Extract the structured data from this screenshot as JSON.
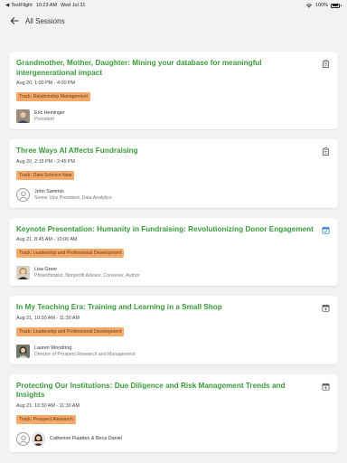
{
  "status": {
    "back_app": "TestFlight",
    "time": "10:23 AM",
    "date": "Wed Jul 31",
    "battery": "100%"
  },
  "nav": {
    "title": "All Sessions"
  },
  "sessions": [
    {
      "title": "Grandmother, Mother, Daughter: Mining your database for meaningful intergenerational impact",
      "time": "Aug 20, 1:00 PM - 4:00 PM",
      "track": "Track: Relationship Management",
      "speaker_name": "Eric Heininger",
      "speaker_role": "President",
      "icon": "clipboard-icon",
      "icon_color": "#555555"
    },
    {
      "title": "Three Ways AI Affects Fundraising",
      "time": "Aug 20, 2:15 PM - 2:45 PM",
      "track": "Track: Data Science Now",
      "speaker_name": "John Sammis",
      "speaker_role": "Senior Vice President, Data Analytics",
      "icon": "clipboard-icon",
      "icon_color": "#555555"
    },
    {
      "title": "Keynote Presentation: Humanity in Fundraising: Revolutionizing Donor Engagement",
      "time": "Aug 21, 8:45 AM - 10:00 AM",
      "track": "Track: Leadership and Professional Development",
      "speaker_name": "Lisa Greer",
      "speaker_role": "Philanthropist, Nonprofit Advisor, Convener, Author",
      "icon": "calendar-check-icon",
      "icon_color": "#2a7fd4"
    },
    {
      "title": "In My Teaching Era: Training and Learning in a Small Shop",
      "time": "Aug 21, 10:30 AM - 11:30 AM",
      "track": "Track: Leadership and Professional Development",
      "speaker_name": "Lauren Woodring",
      "speaker_role": "Director of Prospect Research and Management",
      "icon": "calendar-add-icon",
      "icon_color": "#555555"
    },
    {
      "title": "Protecting Our Institutions: Due Diligence and Risk Management Trends and Insights",
      "time": "Aug 21, 10:30 AM - 11:30 AM",
      "track": "Track: Prospect Research",
      "speaker_name": "Catherine Flaatten & Beca Daniel",
      "speaker_role": "",
      "icon": "calendar-add-icon",
      "icon_color": "#555555"
    }
  ]
}
